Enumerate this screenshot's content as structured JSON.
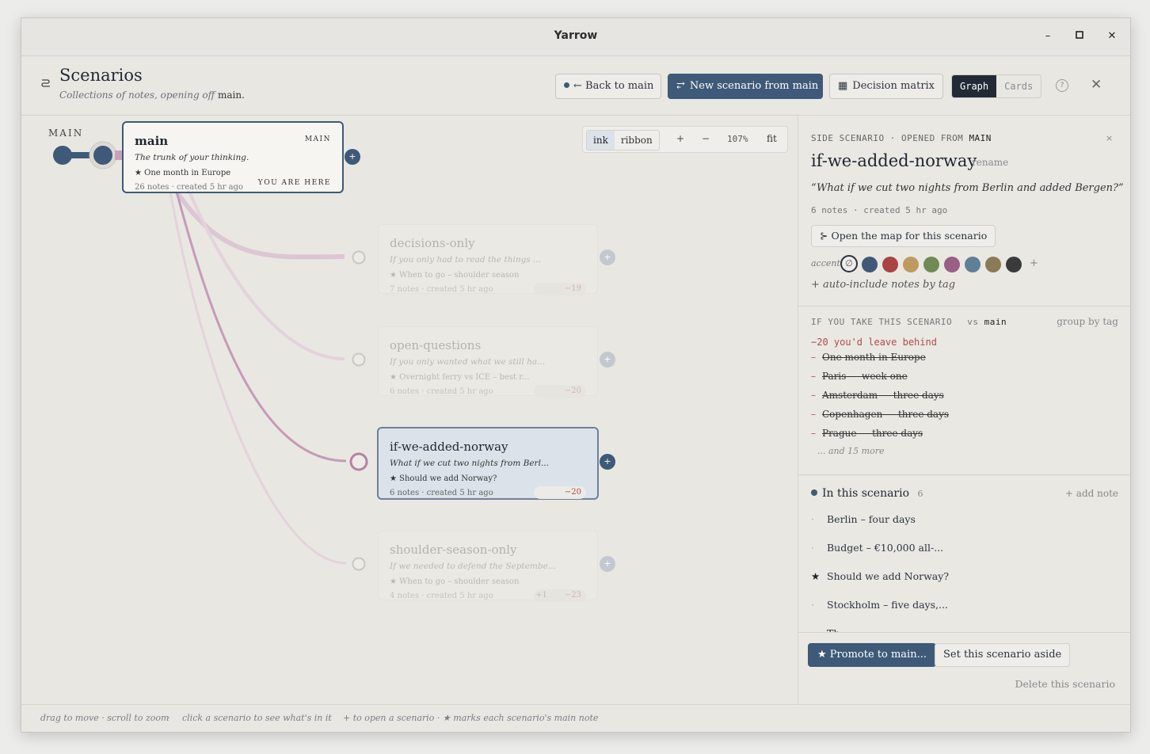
{
  "window": {
    "title": "Yarrow",
    "minimize": "–",
    "maximize": "□",
    "close": "✕"
  },
  "header": {
    "icon": "scenarios-icon",
    "title": "Scenarios",
    "subtitle_prefix": "Collections of notes, opening off",
    "subtitle_branch": "main.",
    "back_label": "← Back to main",
    "new_label": "New scenario from main",
    "matrix_label": "Decision matrix",
    "view_graph": "Graph",
    "view_cards": "Cards",
    "help": "?",
    "close": "✕"
  },
  "canvas": {
    "main_lane_label": "MAIN",
    "zoom_controls": {
      "ink": "ink",
      "ribbon": "ribbon",
      "plus": "+",
      "minus": "−",
      "zoom": "107%",
      "fit": "fit"
    },
    "main_card": {
      "name": "main",
      "badge": "MAIN",
      "question": "The trunk of your thinking.",
      "main_note": "★ One month in Europe",
      "meta": "26 notes · created 5 hr ago",
      "here": "YOU ARE HERE"
    },
    "scenarios": [
      {
        "name": "decisions-only",
        "question": "If you only had to read the things ...",
        "main_note": "★ When to go – shoulder season",
        "meta": "7 notes · created 5 hr ago",
        "plus": "",
        "delta": "−19"
      },
      {
        "name": "open-questions",
        "question": "If you only wanted what we still ha...",
        "main_note": "★ Overnight ferry vs ICE – best r...",
        "meta": "6 notes · created 5 hr ago",
        "plus": "",
        "delta": "−20"
      },
      {
        "name": "if-we-added-norway",
        "question": "What if we cut two nights from Berl...",
        "main_note": "★ Should we add Norway?",
        "meta": "6 notes · created 5 hr ago",
        "plus": "",
        "delta": "−20"
      },
      {
        "name": "shoulder-season-only",
        "question": "If we needed to defend the Septembe...",
        "main_note": "★ When to go – shoulder season",
        "meta": "4 notes · created 5 hr ago",
        "plus": "+1",
        "delta": "−23"
      }
    ],
    "open_plus": "+"
  },
  "panel": {
    "kicker_prefix": "SIDE SCENARIO · OPENED FROM",
    "kicker_branch": "MAIN",
    "close": "×",
    "name": "if-we-added-norway",
    "rename": "rename",
    "question": "“What if we cut two nights from Berlin and added Bergen?”",
    "meta": "6 notes · created 5 hr ago",
    "open_map": "Open the map for this scenario",
    "accent_label": "accent",
    "accent_none": "∅",
    "accent_colors": [
      "#3e5a78",
      "#a94443",
      "#bf9a5f",
      "#6f8a55",
      "#9a5e87",
      "#5f7f97",
      "#8b7a58",
      "#3a3a3a"
    ],
    "accent_add": "+",
    "auto_include": "+ auto-include notes by tag",
    "compare_title": "IF YOU TAKE THIS SCENARIO",
    "compare_vs": "vs",
    "compare_branch": "main",
    "group_by": "group by tag",
    "leave_behind": "−20 you'd leave behind",
    "left_behind": [
      "One month in Europe",
      "Paris — week one",
      "Amsterdam — three days",
      "Copenhagen — three days",
      "Prague — three days"
    ],
    "and_more": "... and 15 more",
    "in_scenario_title": "In this scenario",
    "in_scenario_count": "6",
    "add_note": "+ add note",
    "notes": [
      {
        "mark": "·",
        "text": "Berlin – four days"
      },
      {
        "mark": "·",
        "text": "Budget – €10,000 all-..."
      },
      {
        "mark": "★",
        "text": "Should we add Norway?"
      },
      {
        "mark": "·",
        "text": "Stockholm – five days,..."
      },
      {
        "mark": "·",
        "text": "Th..."
      }
    ],
    "promote": "★ Promote to main...",
    "set_aside": "Set this scenario aside",
    "delete": "Delete this scenario"
  },
  "status": {
    "hint1": "drag to move · scroll to zoom",
    "hint2": "click a scenario to see what's in it",
    "hint3": "+ to open a scenario · ★ marks each scenario's main note"
  }
}
